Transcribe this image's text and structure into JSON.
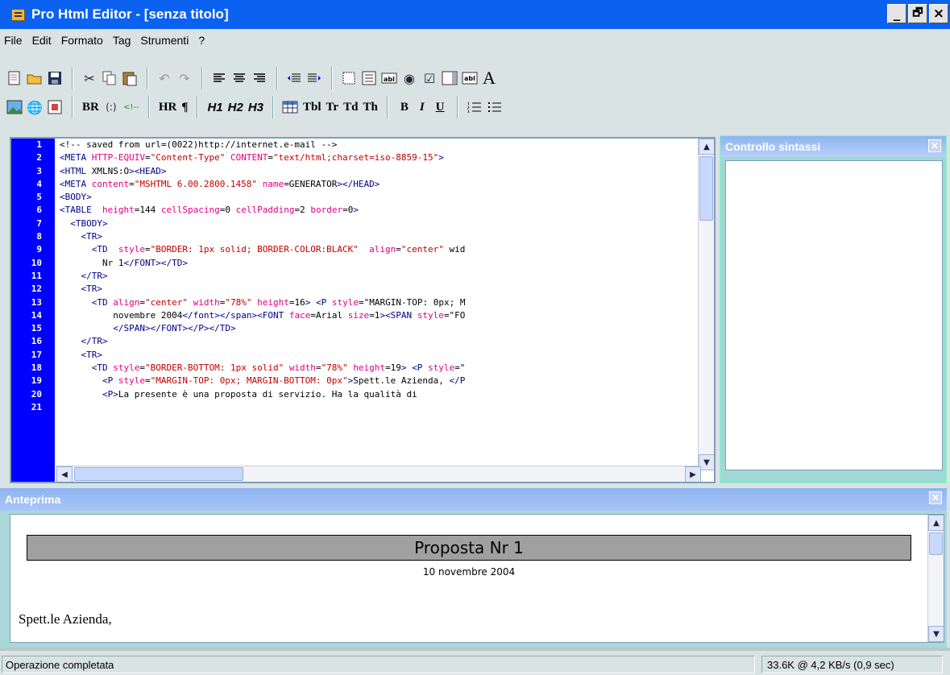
{
  "window": {
    "title": "Pro Html Editor - [senza titolo]",
    "controls": {
      "minimize": "_",
      "maximize": "🗗",
      "close": "×"
    }
  },
  "menu": [
    "File",
    "Edit",
    "Formato",
    "Tag",
    "Strumenti",
    "?"
  ],
  "toolbar_text": {
    "br": "BR",
    "hr": "HR",
    "pilcrow": "¶",
    "h1": "H1",
    "h2": "H2",
    "h3": "H3",
    "tbl": "Tbl",
    "tr": "Tr",
    "td": "Td",
    "th": "Th",
    "bold": "B",
    "italic": "I",
    "underline": "U",
    "font": "A"
  },
  "editor": {
    "line_numbers": [
      "1",
      "2",
      "3",
      "4",
      "5",
      "6",
      "7",
      "8",
      "9",
      "10",
      "11",
      "12",
      "13",
      "14",
      "15",
      "16",
      "17",
      "18",
      "19",
      "20",
      "21"
    ],
    "lines": [
      "<!-- saved from url=(0022)http://internet.e-mail -->",
      "<META HTTP-EQUIV=\"Content-Type\" CONTENT=\"text/html;charset=iso-8859-15\">",
      "<HTML XMLNS:O><HEAD>",
      "<META content=\"MSHTML 6.00.2800.1458\" name=GENERATOR></HEAD>",
      "<BODY>",
      "<TABLE  height=144 cellSpacing=0 cellPadding=2 border=0>",
      "  <TBODY>",
      "    <TR>",
      "      <TD  style=\"BORDER: 1px solid; BORDER-COLOR:BLACK\"  align=\"center\" wid",
      "        Nr 1</FONT></TD>",
      "    </TR>",
      "    <TR>",
      "      <TD align=\"center\" width=\"78%\" height=16> <P style=\"MARGIN-TOP: 0px; M",
      "          novembre 2004</font></span><FONT face=Arial size=1><SPAN style=\"FO",
      "          </SPAN></FONT></P></TD>",
      "    </TR>",
      "    <TR>",
      "      <TD style=\"BORDER-BOTTOM: 1px solid\" width=\"78%\" height=19> <P style=\"",
      "        <P style=\"MARGIN-TOP: 0px; MARGIN-BOTTOM: 0px\">Spett.le Azienda, </P",
      "        <P>La presente è una proposta di servizio. Ha la qualità di",
      ""
    ]
  },
  "syntax_panel": {
    "title": "Controllo sintassi"
  },
  "preview_panel": {
    "title": "Anteprima",
    "doc_title": "Proposta Nr 1",
    "doc_date": "10 novembre 2004",
    "doc_greeting": "Spett.le Azienda,"
  },
  "status": {
    "left": "Operazione completata",
    "right": "33.6K @ 4,2 KB/s (0,9 sec)"
  },
  "colors": {
    "titlebar": "#0c62f0",
    "gutter": "#0000ff",
    "tag": "#00008b",
    "attr": "#e0008a",
    "value": "#c00000"
  }
}
